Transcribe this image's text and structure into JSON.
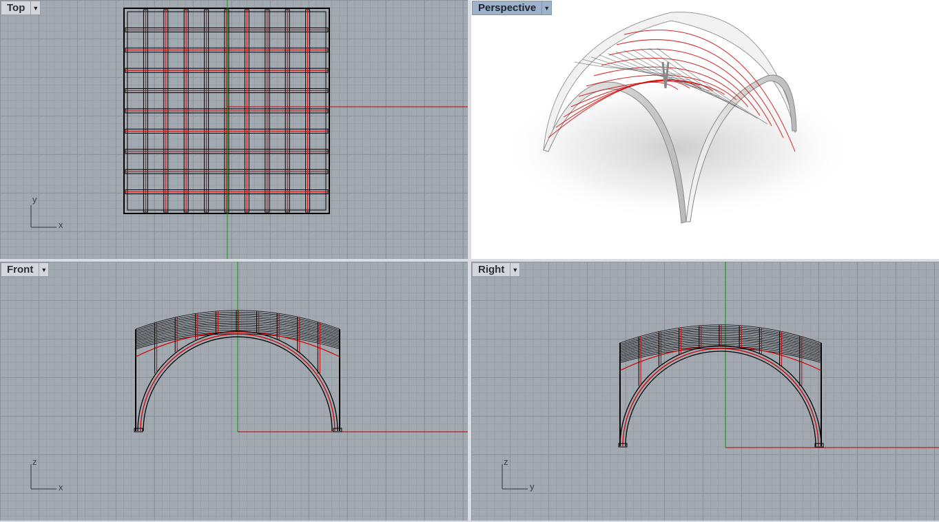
{
  "viewports": {
    "top": {
      "label": "Top",
      "axes": [
        "y",
        "x"
      ]
    },
    "perspective": {
      "label": "Perspective"
    },
    "front": {
      "label": "Front",
      "axes": [
        "z",
        "x"
      ]
    },
    "right": {
      "label": "Right",
      "axes": [
        "z",
        "y"
      ]
    }
  },
  "colors": {
    "viewport_bg": "#a3a9b1",
    "active_tab": "#9eb2c9",
    "x_axis": "#c00000",
    "y_axis": "#00a000",
    "wire": "#000000",
    "edge_highlight": "#e00000"
  },
  "icons": {
    "viewport_menu": "dropdown-arrow-icon"
  }
}
